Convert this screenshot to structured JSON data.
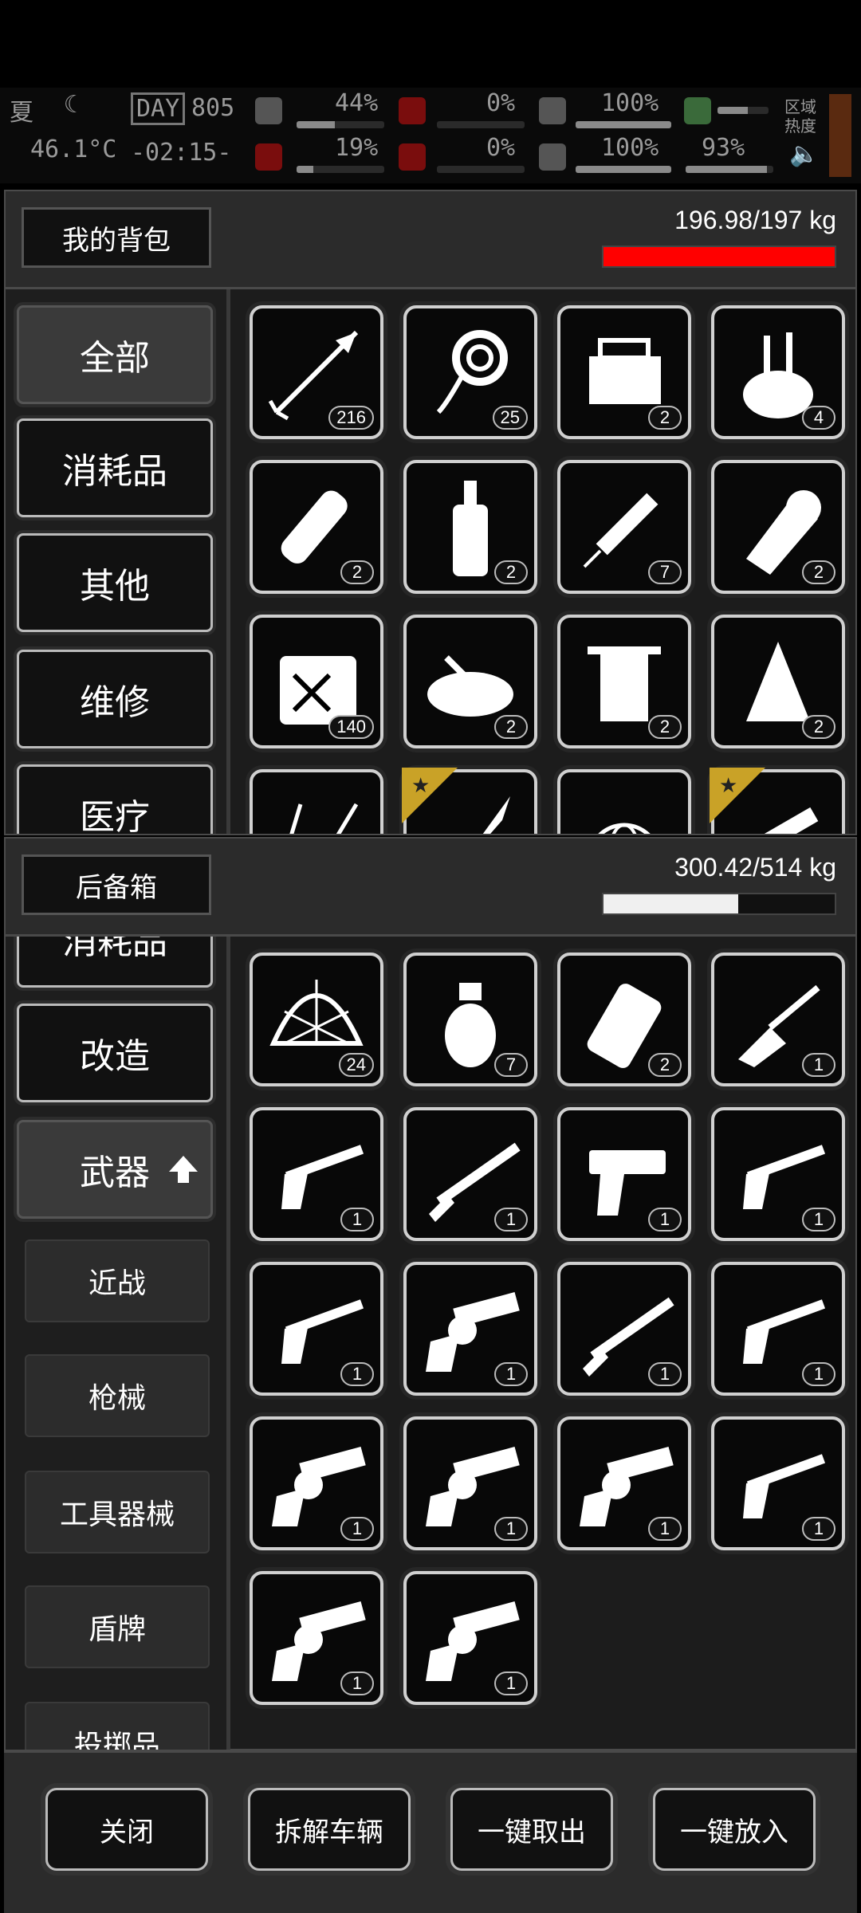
{
  "hud": {
    "weather": "夏",
    "temperature": "46.1°C",
    "day_label": "DAY",
    "day_number": "805",
    "clock": "-02:15-",
    "stats": [
      {
        "icon": "medkit-icon",
        "value": "44%",
        "level": 0.44
      },
      {
        "icon": "stomach-icon",
        "value": "19%",
        "level": 0.19
      },
      {
        "icon": "hunger-icon",
        "value": "0%",
        "level": 0.0
      },
      {
        "icon": "blood-icon",
        "value": "0%",
        "level": 0.0
      },
      {
        "icon": "armor-icon",
        "value": "100%",
        "level": 1.0
      },
      {
        "icon": "heart-icon",
        "value": "100%",
        "level": 1.0
      },
      {
        "icon": "person-icon",
        "value": "",
        "level": 0.6
      },
      {
        "icon": "stamina-icon",
        "value": "93%",
        "level": 0.93
      }
    ],
    "zone_label": "区域热度",
    "colors": {
      "bar": "#8a8a8a",
      "alert": "#7a0d0d"
    }
  },
  "backpack": {
    "title": "我的背包",
    "weight": "196.98/197 kg",
    "fill": 0.999,
    "bar_color": "#ff0000",
    "categories": [
      "全部",
      "消耗品",
      "其他",
      "维修",
      "医疗"
    ],
    "items": [
      {
        "icon": "arrow-icon",
        "count": "216"
      },
      {
        "icon": "rope-icon",
        "count": "25"
      },
      {
        "icon": "toolbox-icon",
        "count": "2"
      },
      {
        "icon": "tool-bag-icon",
        "count": "4"
      },
      {
        "icon": "bandage-roll-icon",
        "count": "2"
      },
      {
        "icon": "bottle-icon",
        "count": "2"
      },
      {
        "icon": "syringe-icon",
        "count": "7"
      },
      {
        "icon": "cloth-roll-icon",
        "count": "2"
      },
      {
        "icon": "fuel-can-icon",
        "count": "140"
      },
      {
        "icon": "soup-bowl-icon",
        "count": "2"
      },
      {
        "icon": "towel-icon",
        "count": "2"
      },
      {
        "icon": "rag-icon",
        "count": "2"
      },
      {
        "icon": "wire-icon",
        "count": ""
      },
      {
        "icon": "blade-icon",
        "count": "",
        "starred": true
      },
      {
        "icon": "globe-net-icon",
        "count": ""
      },
      {
        "icon": "caliper-icon",
        "count": "",
        "starred": true
      }
    ]
  },
  "trunk": {
    "title": "后备箱",
    "weight": "300.42/514 kg",
    "fill": 0.584,
    "bar_color": "#f0f0f0",
    "categories_top": [
      "消耗品",
      "改造"
    ],
    "active_category": "武器",
    "subcategories": [
      "近战",
      "枪械",
      "工具器械",
      "盾牌",
      "投掷品"
    ],
    "items": [
      {
        "icon": "helmet-net-icon",
        "count": "24"
      },
      {
        "icon": "grenade-icon",
        "count": "7"
      },
      {
        "icon": "canister-icon",
        "count": "2"
      },
      {
        "icon": "crossbow-icon",
        "count": "1"
      },
      {
        "icon": "revolver-long-icon",
        "count": "1"
      },
      {
        "icon": "rifle-icon",
        "count": "1"
      },
      {
        "icon": "pistol-icon",
        "count": "1"
      },
      {
        "icon": "revolver-long-icon",
        "count": "1"
      },
      {
        "icon": "revolver-long-icon",
        "count": "1"
      },
      {
        "icon": "revolver-icon",
        "count": "1"
      },
      {
        "icon": "rifle-icon",
        "count": "1"
      },
      {
        "icon": "revolver-long-icon",
        "count": "1"
      },
      {
        "icon": "revolver-icon",
        "count": "1"
      },
      {
        "icon": "revolver-icon",
        "count": "1"
      },
      {
        "icon": "revolver-icon",
        "count": "1"
      },
      {
        "icon": "revolver-long-icon",
        "count": "1"
      },
      {
        "icon": "revolver-icon",
        "count": "1"
      },
      {
        "icon": "revolver-icon",
        "count": "1"
      }
    ]
  },
  "footer": {
    "buttons": [
      "关闭",
      "拆解车辆",
      "一键取出",
      "一键放入"
    ]
  }
}
